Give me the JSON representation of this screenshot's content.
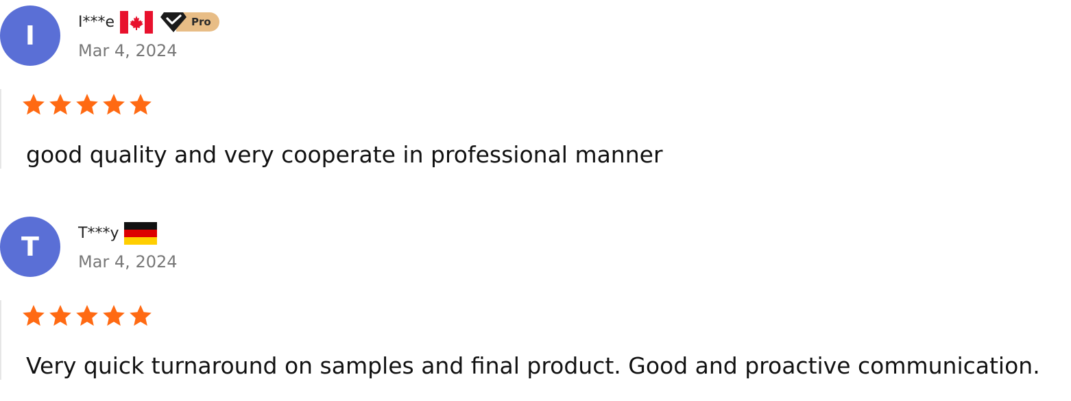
{
  "reviews": [
    {
      "avatar_letter": "I",
      "user_name": "I***e",
      "country_flag": "canada-flag-icon",
      "pro_badge": "Pro",
      "date": "Mar 4, 2024",
      "rating": 5,
      "text": "good quality and very cooperate in professional manner"
    },
    {
      "avatar_letter": "T",
      "user_name": "T***y",
      "country_flag": "germany-flag-icon",
      "date": "Mar 4, 2024",
      "rating": 5,
      "text": "Very quick turnaround on samples and final product. Good and proactive communication."
    }
  ],
  "colors": {
    "avatar_bg": "#5a6fd6",
    "star": "#ff6a13",
    "pro_badge_bg": "#e8bd86",
    "date_text": "#777777"
  }
}
